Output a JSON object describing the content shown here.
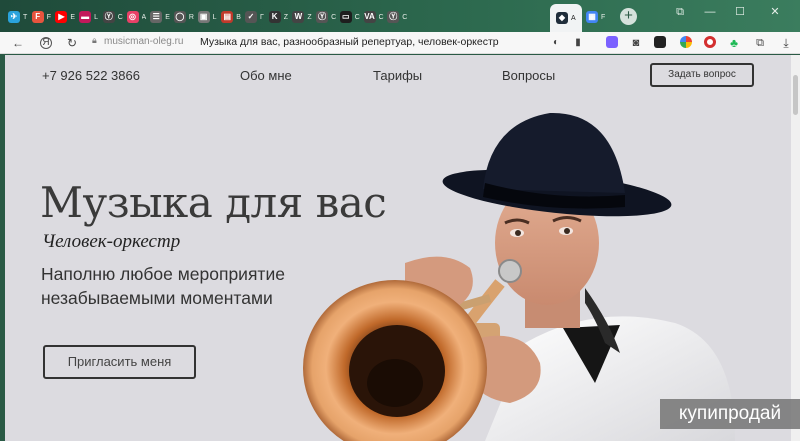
{
  "browser": {
    "tabs": [
      {
        "label": "T",
        "color": "#2aa3dc",
        "glyph": "✈"
      },
      {
        "label": "F",
        "color": "#e8543e",
        "glyph": "F"
      },
      {
        "label": "E",
        "color": "#ff0000",
        "glyph": "▶"
      },
      {
        "label": "L",
        "color": "#c2185b",
        "glyph": "▬"
      },
      {
        "label": "C",
        "color": "#444",
        "glyph": "Ⓨ"
      },
      {
        "label": "А",
        "color": "#e84067",
        "glyph": "◎"
      },
      {
        "label": "E",
        "color": "#666",
        "glyph": "☰"
      },
      {
        "label": "R",
        "color": "#555",
        "glyph": "◯"
      },
      {
        "label": "L",
        "color": "#777",
        "glyph": "▣"
      },
      {
        "label": "B",
        "color": "#c0392b",
        "glyph": "▤"
      },
      {
        "label": "Г",
        "color": "#555",
        "glyph": "✓"
      },
      {
        "label": "Z",
        "color": "#333",
        "glyph": "K"
      },
      {
        "label": "Z",
        "color": "#444",
        "glyph": "W"
      },
      {
        "label": "C",
        "color": "#555",
        "glyph": "Ⓨ"
      },
      {
        "label": "C",
        "color": "#1e1e1e",
        "glyph": "▭"
      },
      {
        "label": "C",
        "color": "#444",
        "glyph": "VA"
      },
      {
        "label": "C",
        "color": "#555",
        "glyph": "Ⓨ"
      }
    ],
    "active_tab": {
      "label": "A",
      "color": "#1f2d3a",
      "glyph": "◆"
    },
    "last_tab": {
      "label": "F",
      "color": "#4285f4",
      "glyph": "▦"
    },
    "url_domain": "musicman-oleg.ru",
    "page_title": "Музыка для вас, разнообразный репертуар, человек-оркестр"
  },
  "site": {
    "phone": "+7 926 522 3866",
    "nav": {
      "about": "Обо мне",
      "prices": "Тарифы",
      "faq": "Вопросы"
    },
    "ask_button": "Задать вопрос",
    "hero_title": "Музыка для вас",
    "hero_subtitle": "Человек-оркестр",
    "hero_text_line1": "Наполню любое мероприятие",
    "hero_text_line2": "незабываемыми моментами",
    "invite_button": "Пригласить меня"
  },
  "watermark": "купипродай"
}
